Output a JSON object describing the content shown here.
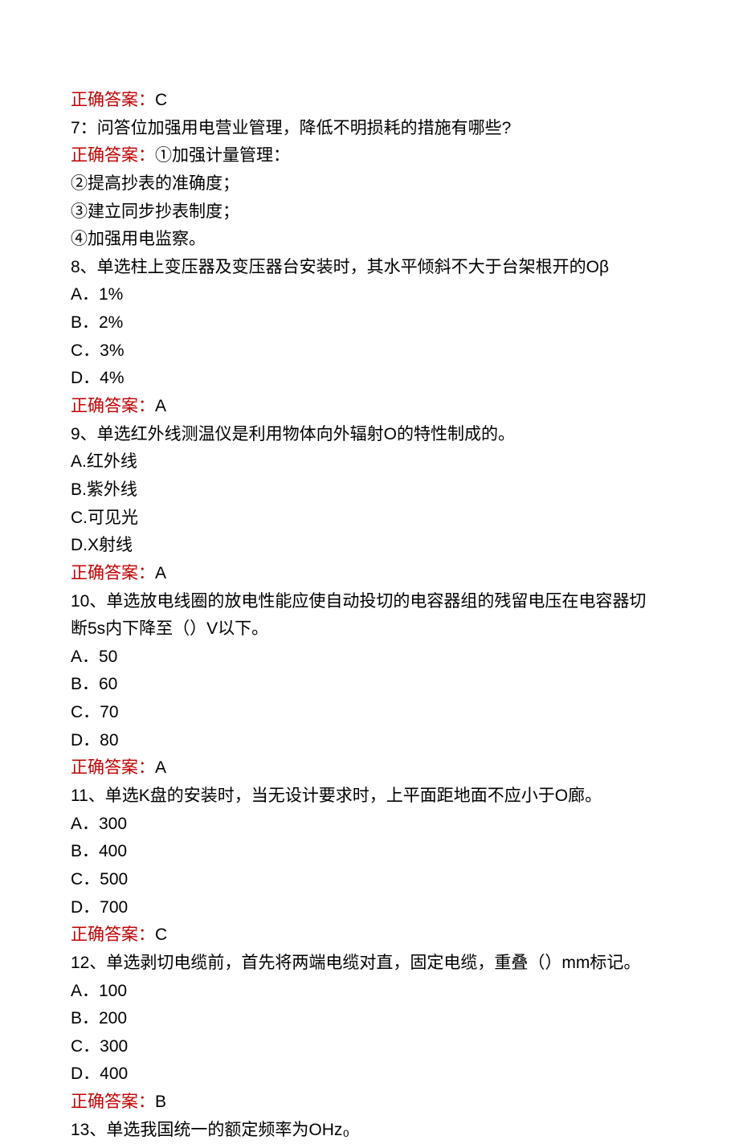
{
  "q6": {
    "answer_label": "正确答案：",
    "answer_value": "C"
  },
  "q7": {
    "prefix": "7：",
    "question": "问答位加强用电营业管理，降低不明损耗的措施有哪些?",
    "answer_label": "正确答案：",
    "answer_line1": "①加强计量管理：",
    "line2": "②提高抄表的准确度；",
    "line3": "③建立同步抄表制度；",
    "line4": "④加强用电监察。"
  },
  "q8": {
    "question": "8、单选柱上变压器及变压器台安装时，其水平倾斜不大于台架根开的Oβ",
    "optA": "A．1%",
    "optB": "B．2%",
    "optC": "C．3%",
    "optD": "D．4%",
    "answer_label": "正确答案：",
    "answer_value": "A"
  },
  "q9": {
    "question": "9、单选红外线测温仪是利用物体向外辐射O的特性制成的。",
    "optA": "A.红外线",
    "optB": "B.紫外线",
    "optC": "C.可见光",
    "optD": "D.X射线",
    "answer_label": "正确答案：",
    "answer_value": "A"
  },
  "q10": {
    "question_l1": "10、单选放电线圈的放电性能应使自动投切的电容器组的残留电压在电容器切",
    "question_l2": "断5s内下降至（）V以下。",
    "optA": "A．50",
    "optB": "B．60",
    "optC": "C．70",
    "optD": "D．80",
    "answer_label": "正确答案：",
    "answer_value": "A"
  },
  "q11": {
    "question": "11、单选K盘的安装时，当无设计要求时，上平面距地面不应小于O廊。",
    "optA": "A．300",
    "optB": "B．400",
    "optC": "C．500",
    "optD": "D．700",
    "answer_label": "正确答案：",
    "answer_value": "C"
  },
  "q12": {
    "question": "12、单选剥切电缆前，首先将两端电缆对直，固定电缆，重叠（）mm标记。",
    "optA": "A．100",
    "optB": "B．200",
    "optC": "C．300",
    "optD": "D．400",
    "answer_label": "正确答案：",
    "answer_value": "B"
  },
  "q13": {
    "question": "13、单选我国统一的额定频率为OHz₀"
  }
}
